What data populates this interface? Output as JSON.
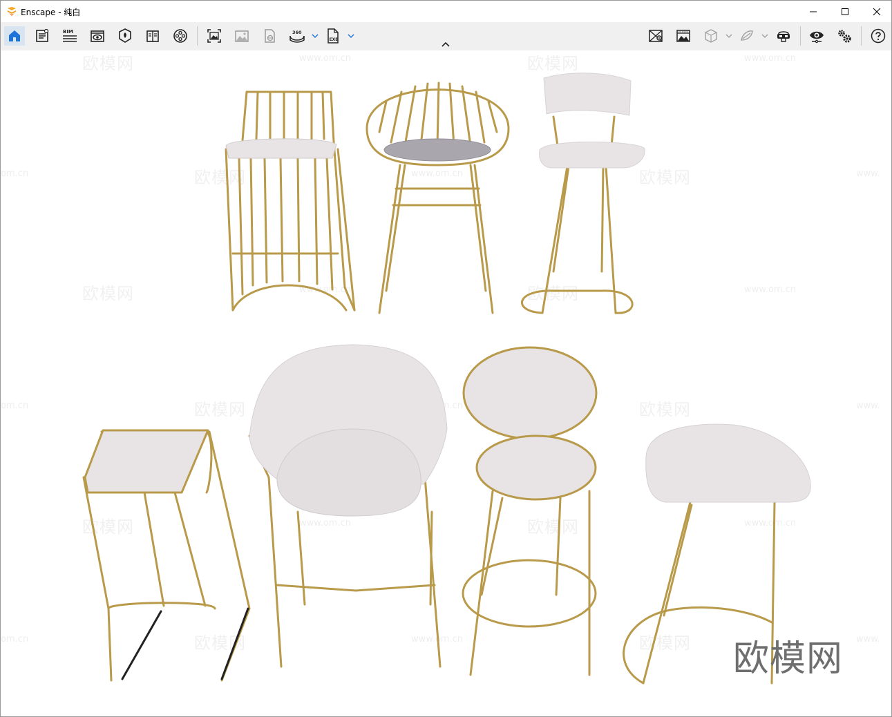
{
  "titlebar": {
    "title": "Enscape - 纯白",
    "controls": [
      "minimize-icon",
      "maximize-icon",
      "close-icon"
    ]
  },
  "toolbar": {
    "left_tools": [
      {
        "icon": "home-icon",
        "active": true
      },
      {
        "icon": "asset-library-icon"
      },
      {
        "icon": "bim-icon",
        "label": "BIM"
      },
      {
        "icon": "views-icon"
      },
      {
        "icon": "material-editor-icon"
      },
      {
        "icon": "book-icon"
      },
      {
        "icon": "video-reel-icon"
      },
      {
        "icon": "screenshot-icon"
      },
      {
        "icon": "batch-render-icon"
      },
      {
        "icon": "web-standalone-icon"
      },
      {
        "icon": "panorama-360-icon",
        "label": "360",
        "dropdown": true
      },
      {
        "icon": "export-exe-icon",
        "label": "EXE",
        "dropdown": true
      }
    ],
    "right_tools": [
      {
        "icon": "map-icon"
      },
      {
        "icon": "rendering-preview-icon"
      },
      {
        "icon": "section-cube-icon",
        "dropdown": true
      },
      {
        "icon": "orthographic-icon",
        "dropdown": true
      },
      {
        "icon": "vr-headset-icon"
      },
      {
        "icon": "eye-icon"
      },
      {
        "icon": "settings-icon"
      },
      {
        "icon": "help-icon"
      }
    ]
  },
  "viewport": {
    "watermark_text": "欧模网",
    "watermark_url": "www.om.cn",
    "watermark_url_partial": "om.cn",
    "watermark_url_partial_right": "www.",
    "brand_text": "欧模网",
    "colors": {
      "gold": "#b89a4a",
      "fabric": "#e8e4e6",
      "cushion": "#a9a6ad"
    }
  }
}
